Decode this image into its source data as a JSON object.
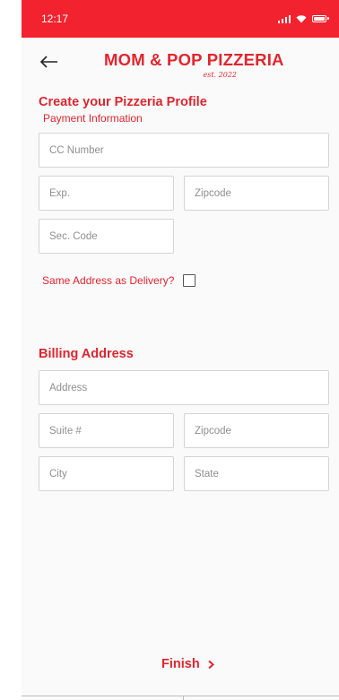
{
  "status_bar": {
    "time": "12:17"
  },
  "header": {
    "back_icon": "left-arrow-icon",
    "brand_title": "MOM & POP PIZZERIA",
    "brand_subtitle": "est. 2022"
  },
  "payment": {
    "title": "Create your Pizzeria Profile",
    "subtitle": "Payment Information",
    "cc_number_placeholder": "CC Number",
    "exp_placeholder": "Exp.",
    "zipcode_placeholder": "Zipcode",
    "sec_code_placeholder": "Sec. Code"
  },
  "same_address": {
    "label": "Same Address as Delivery?",
    "checked": false
  },
  "billing": {
    "title": "Billing Address",
    "address_placeholder": "Address",
    "suite_placeholder": "Suite #",
    "zipcode_placeholder": "Zipcode",
    "city_placeholder": "City",
    "state_placeholder": "State"
  },
  "footer": {
    "finish_label": "Finish",
    "finish_icon": "chevron-right-icon"
  },
  "colors": {
    "brand_red": "#e0262f",
    "status_bar": "#f2232e"
  }
}
